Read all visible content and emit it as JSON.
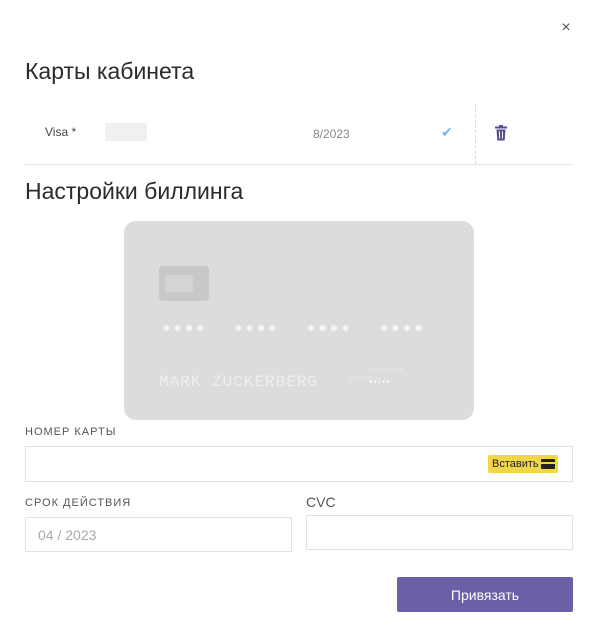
{
  "modal": {
    "close_icon": "×"
  },
  "cards_section": {
    "title": "Карты кабинета",
    "cards": [
      {
        "brand": "Visa *",
        "expiry": "8/2023",
        "check_icon": "✔"
      }
    ]
  },
  "billing_section": {
    "title": "Настройки биллинга",
    "card_preview": {
      "number_groups": [
        "●●●●",
        "●●●●",
        "●●●●",
        "●●●●"
      ],
      "holder": "MARK ZUCKERBERG",
      "valid_label": "VALID THRU",
      "month_year_label": "MONTH/YEAR",
      "expiry_placeholder": "••/••"
    },
    "card_number": {
      "label": "НОМЕР КАРТЫ",
      "value": "",
      "paste_label": "Вставить"
    },
    "expiry": {
      "label": "СРОК ДЕЙСТВИЯ",
      "placeholder": "04 / 2023"
    },
    "cvc": {
      "label": "CVC",
      "value": ""
    },
    "submit_label": "Привязать"
  },
  "colors": {
    "accent": "#6c5fa8",
    "paste_button": "#f2d64a",
    "check": "#7db4e6"
  }
}
